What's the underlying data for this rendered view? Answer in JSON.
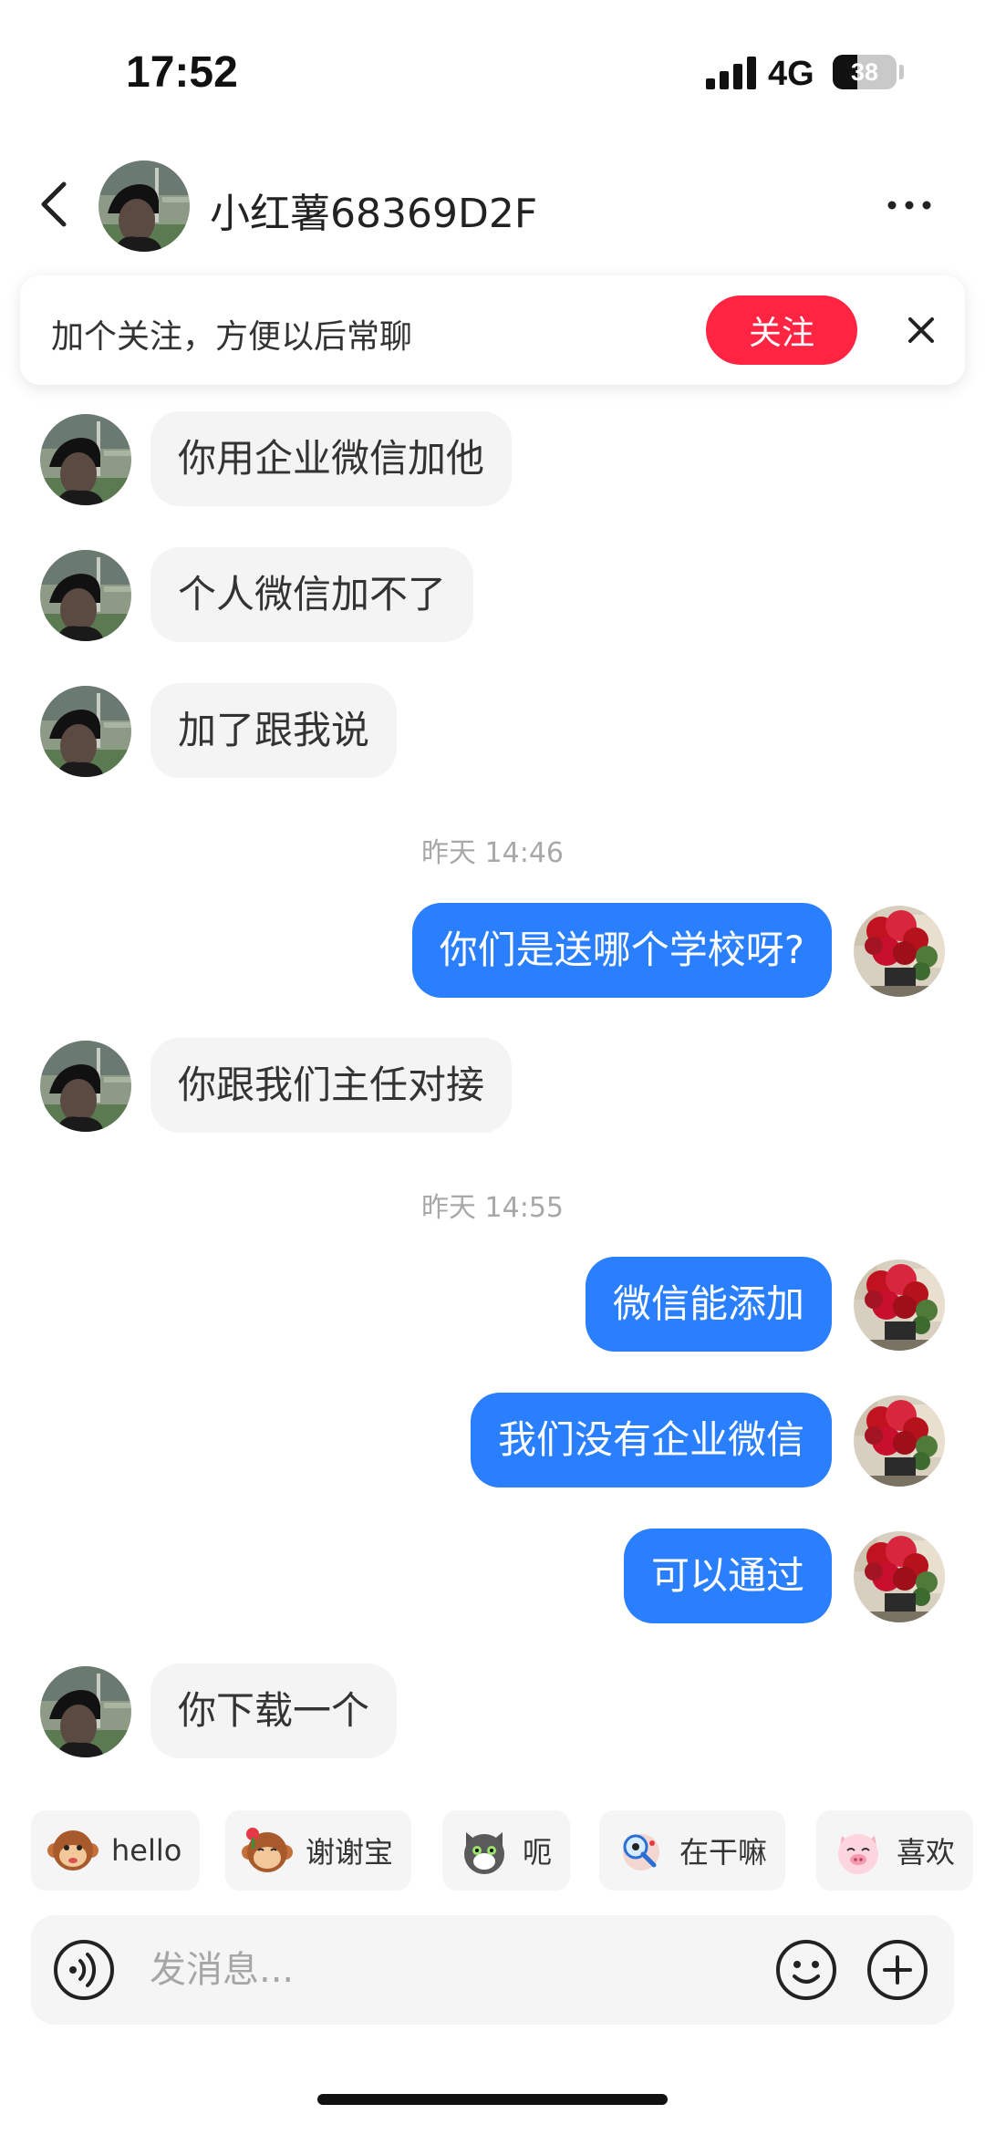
{
  "status_bar": {
    "time": "17:52",
    "network": "4G",
    "battery": "38",
    "battery_level_percent": 38
  },
  "header": {
    "title": "小红薯68369D2F",
    "back_icon": "chevron-left-icon",
    "more_icon": "more-dots-icon"
  },
  "follow_banner": {
    "text": "加个关注，方便以后常聊",
    "button_label": "关注",
    "button_color": "#ff2442",
    "close_icon": "close-icon"
  },
  "chat": {
    "timestamps": [
      "昨天 14:46",
      "昨天 14:55"
    ],
    "messages": [
      {
        "from": "them",
        "text": "你用企业微信加他"
      },
      {
        "from": "them",
        "text": "个人微信加不了"
      },
      {
        "from": "them",
        "text": "加了跟我说"
      },
      {
        "from": "me",
        "text": "你们是送哪个学校呀?"
      },
      {
        "from": "them",
        "text": "你跟我们主任对接"
      },
      {
        "from": "me",
        "text": "微信能添加"
      },
      {
        "from": "me",
        "text": "我们没有企业微信"
      },
      {
        "from": "me",
        "text": "可以通过"
      },
      {
        "from": "them",
        "text": "你下载一个"
      }
    ]
  },
  "quick_replies": [
    {
      "label": "hello",
      "icon": "monkey-sticker-icon"
    },
    {
      "label": "谢谢宝",
      "icon": "monkey-flower-sticker-icon"
    },
    {
      "label": "呃",
      "icon": "cat-sticker-icon"
    },
    {
      "label": "在干嘛",
      "icon": "magnifier-sticker-icon"
    },
    {
      "label": "喜欢",
      "icon": "pig-sticker-icon"
    }
  ],
  "input": {
    "placeholder": "发消息...",
    "value": "",
    "voice_icon": "voice-icon",
    "emoji_icon": "emoji-icon",
    "plus_icon": "plus-icon"
  },
  "colors": {
    "outgoing_bubble": "#2a7fff",
    "incoming_bubble": "#f4f4f4",
    "accent_red": "#ff2442"
  }
}
